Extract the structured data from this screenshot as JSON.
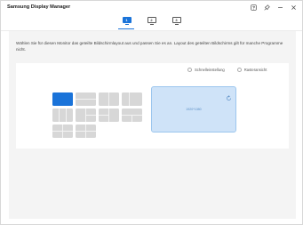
{
  "app": {
    "title": "Samsung Display Manager"
  },
  "window_controls": [
    {
      "name": "help-icon"
    },
    {
      "name": "pin-icon"
    },
    {
      "name": "minimize-icon"
    },
    {
      "name": "close-icon"
    }
  ],
  "monitor_tabs": [
    {
      "label": "1",
      "active": true
    },
    {
      "label": "2",
      "active": false
    },
    {
      "label": "3",
      "active": false
    }
  ],
  "description": "Wählen Sie für diesen Monitor das geteilte Bildschirmlayout aus und passen Sie es an. Layout des geteilten Bildschirms gilt für manche Programme nicht.",
  "options": {
    "quick_setting": "Schnelleinstellung",
    "grid_view": "Rasteransicht"
  },
  "preview": {
    "resolution": "1920*1080"
  },
  "colors": {
    "accent": "#1a73d9",
    "preview_fill": "#cfe3f8",
    "tile": "#d7d7d7",
    "background": "#f4f4f4"
  }
}
